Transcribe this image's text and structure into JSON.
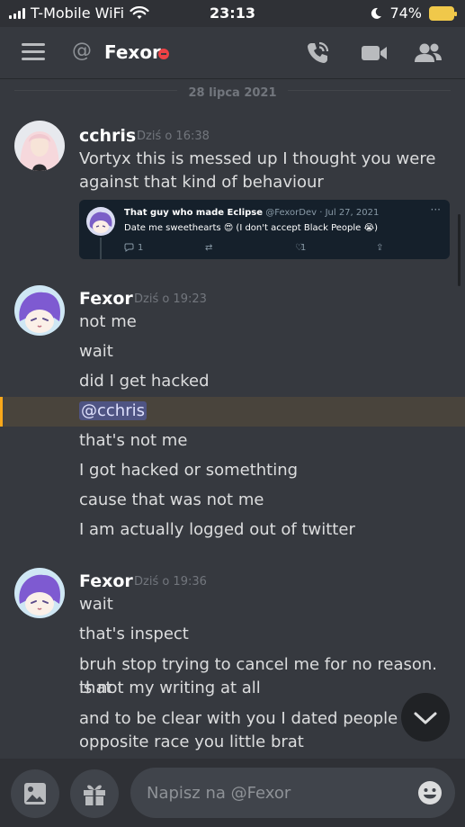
{
  "status_bar": {
    "carrier": "T-Mobile WiFi",
    "time": "23:13",
    "battery": "74%"
  },
  "header": {
    "channel_name": "Fexor",
    "at_symbol": "@",
    "icons": [
      "menu-icon",
      "phone-icon",
      "video-icon",
      "members-icon"
    ]
  },
  "date_divider": "28 lipca 2021",
  "messages": [
    {
      "author": "cchris",
      "timestamp": "Dziś o 16:38",
      "lines": [
        "Vortyx this is messed up I thought you were against that kind of behaviour"
      ],
      "embed": {
        "name": "That guy who made Eclipse",
        "handle": "@FexorDev",
        "date": "· Jul 27, 2021",
        "text_before": "Date me sweethearts ",
        "emoji_1": "😍",
        "text_after": " (I don't accept Black People ",
        "emoji_2": "😭",
        "text_end": ")",
        "reply_count": "1",
        "like_count": "1"
      }
    },
    {
      "author": "Fexor",
      "timestamp": "Dziś o 19:23",
      "lines": [
        "not me",
        "wait",
        "did I get hacked",
        "@cchris",
        "that's not me",
        "I got hacked or somethting",
        "cause that was not me",
        "I am actually logged out of twitter"
      ]
    },
    {
      "author": "Fexor",
      "timestamp": "Dziś o 19:36",
      "lines": [
        "wait",
        "that's inspect",
        "bruh stop trying to cancel me for no reason. that",
        "is not my writing at all",
        "and to be clear with you I dated people the",
        "opposite race you little brat"
      ]
    }
  ],
  "composer": {
    "placeholder": "Napisz na @Fexor"
  },
  "colors": {
    "background": "#36393f",
    "header": "#2f3136",
    "mention_highlight": "#49443c",
    "mention_bar": "#faa81a",
    "dnd_status": "#ed4245",
    "embed_bg": "#15202b"
  }
}
